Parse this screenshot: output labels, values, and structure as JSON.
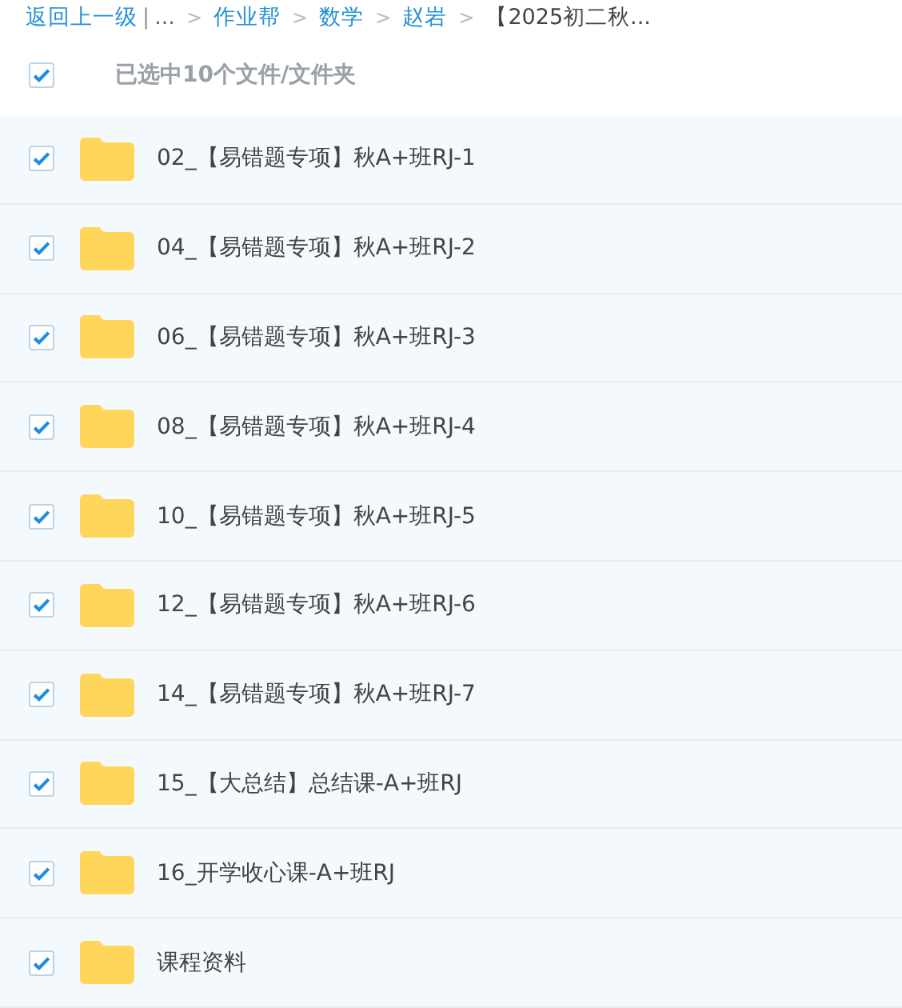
{
  "breadcrumb": [
    {
      "kind": "link",
      "text": "返回上一级"
    },
    {
      "kind": "divider",
      "text": "|"
    },
    {
      "kind": "text",
      "text": "..."
    },
    {
      "kind": "sep",
      "text": ">"
    },
    {
      "kind": "link",
      "text": "作业帮"
    },
    {
      "kind": "sep",
      "text": ">"
    },
    {
      "kind": "link",
      "text": "数学"
    },
    {
      "kind": "sep",
      "text": ">"
    },
    {
      "kind": "link",
      "text": "赵岩"
    },
    {
      "kind": "sep",
      "text": ">"
    },
    {
      "kind": "current",
      "text": "【2025初二秋..."
    }
  ],
  "selection": {
    "checked": true,
    "label": "已选中10个文件/文件夹"
  },
  "files": [
    {
      "name": "02_【易错题专项】秋A+班RJ-1",
      "checked": true
    },
    {
      "name": "04_【易错题专项】秋A+班RJ-2",
      "checked": true
    },
    {
      "name": "06_【易错题专项】秋A+班RJ-3",
      "checked": true
    },
    {
      "name": "08_【易错题专项】秋A+班RJ-4",
      "checked": true
    },
    {
      "name": "10_【易错题专项】秋A+班RJ-5",
      "checked": true
    },
    {
      "name": "12_【易错题专项】秋A+班RJ-6",
      "checked": true
    },
    {
      "name": "14_【易错题专项】秋A+班RJ-7",
      "checked": true
    },
    {
      "name": "15_【大总结】总结课-A+班RJ",
      "checked": true
    },
    {
      "name": "16_开学收心课-A+班RJ",
      "checked": true
    },
    {
      "name": "课程资料",
      "checked": true
    }
  ]
}
